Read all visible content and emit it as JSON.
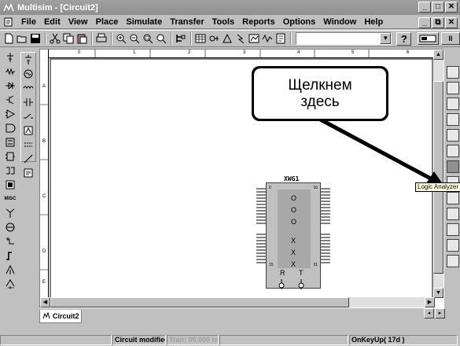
{
  "window": {
    "title": "Multisim - [Circuit2]",
    "minimize": "_",
    "maximize": "□",
    "close": "✕"
  },
  "menu": {
    "items": [
      "File",
      "Edit",
      "View",
      "Place",
      "Simulate",
      "Transfer",
      "Tools",
      "Reports",
      "Options",
      "Window",
      "Help"
    ],
    "mdi_minimize": "_",
    "mdi_restore": "⧉",
    "mdi_close": "✕"
  },
  "toolbar": {
    "combo_value": "",
    "help_label": "?",
    "pause_label": "II"
  },
  "left_toolbar": {
    "misc_label": "MISC"
  },
  "ruler": {
    "columns": [
      "0",
      "1",
      "2",
      "3",
      "4",
      "5",
      "6"
    ],
    "rows": [
      "A",
      "B",
      "C",
      "D",
      "E"
    ]
  },
  "callout": {
    "line1": "Щелкнем",
    "line2": "здесь"
  },
  "tooltip": "Logic Analyzer",
  "instrument": {
    "refdes": "XWG1",
    "pin_top_left": "0",
    "pin_top_right": "16",
    "pin_bottom_left": "15",
    "pin_bottom_right": "31",
    "marks": [
      "O",
      "O",
      "O",
      "X",
      "X",
      "X"
    ],
    "r_label": "R",
    "t_label": "T"
  },
  "tabs": [
    {
      "label": "Circuit2"
    }
  ],
  "tab_nav": {
    "prev": "◂",
    "next": "▸"
  },
  "status": {
    "blank1": "",
    "modified": "Circuit modified",
    "tran": "Tran: 00.000 ms",
    "blank2": "",
    "key": "OnKeyUp( 17d )"
  }
}
